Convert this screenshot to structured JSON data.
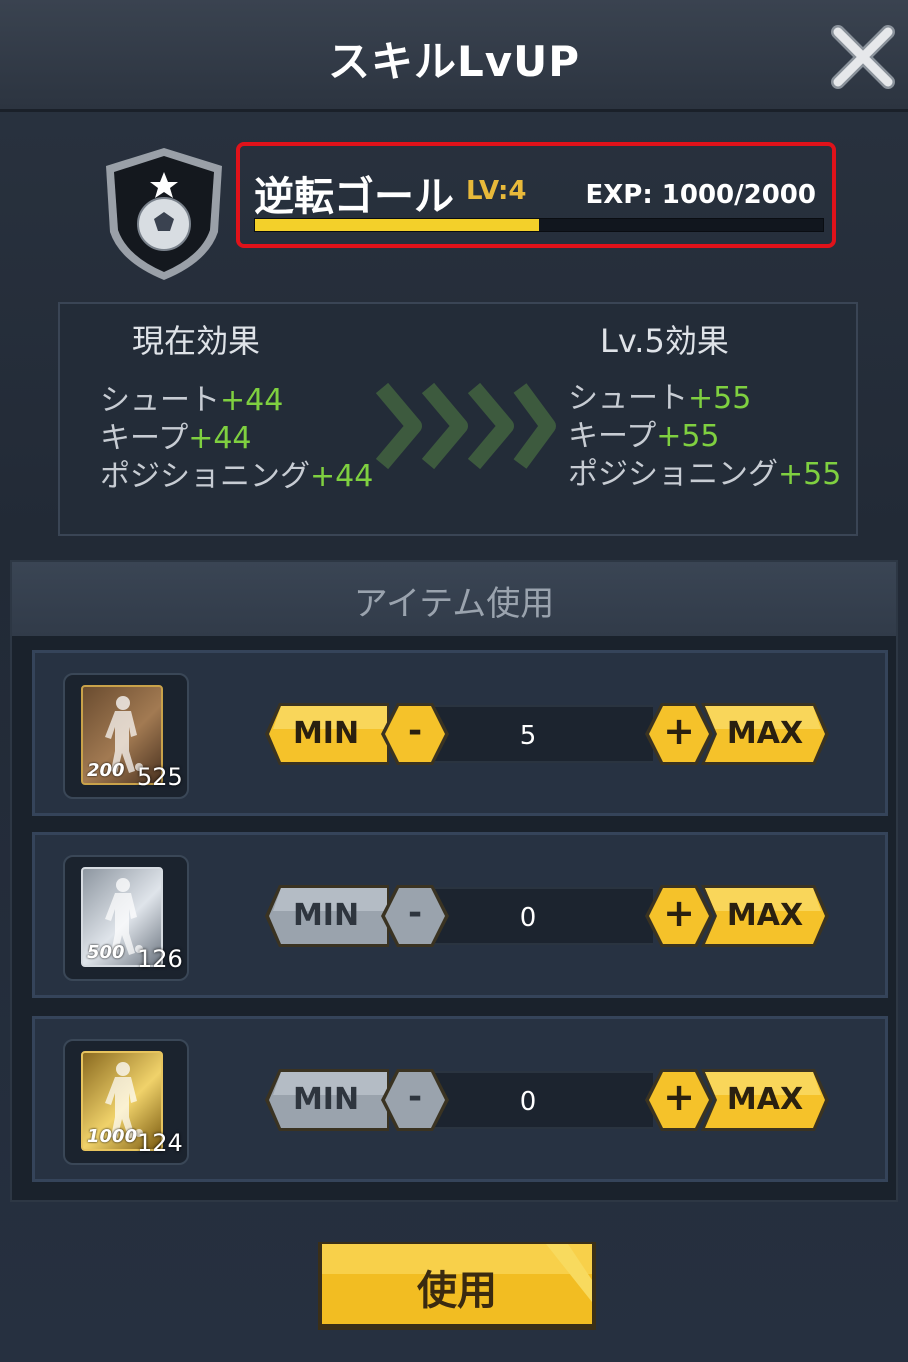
{
  "header": {
    "title": "スキルLvUP"
  },
  "skill": {
    "name": "逆転ゴール",
    "level_label": "LV:4",
    "exp_label": "EXP: 1000/2000",
    "exp_progress": 0.5
  },
  "effects": {
    "current_title": "現在効果",
    "next_title": "Lv.5効果",
    "current": [
      {
        "label": "シュート",
        "value": "+44"
      },
      {
        "label": "キープ",
        "value": "+44"
      },
      {
        "label": "ポジショニング",
        "value": "+44"
      }
    ],
    "next": [
      {
        "label": "シュート",
        "value": "+55"
      },
      {
        "label": "キープ",
        "value": "+55"
      },
      {
        "label": "ポジショニング",
        "value": "+55"
      }
    ]
  },
  "items": {
    "title": "アイテム使用",
    "rows": [
      {
        "card_value": "200",
        "count": "525",
        "quantity": "5",
        "min_label": "MIN",
        "max_label": "MAX",
        "minus_label": "-",
        "plus_label": "+",
        "tier": "bronze",
        "min_enabled": true
      },
      {
        "card_value": "500",
        "count": "126",
        "quantity": "0",
        "min_label": "MIN",
        "max_label": "MAX",
        "minus_label": "-",
        "plus_label": "+",
        "tier": "silver",
        "min_enabled": false
      },
      {
        "card_value": "1000",
        "count": "124",
        "quantity": "0",
        "min_label": "MIN",
        "max_label": "MAX",
        "minus_label": "-",
        "plus_label": "+",
        "tier": "gold",
        "min_enabled": false
      }
    ]
  },
  "use_button": {
    "label": "使用"
  },
  "colors": {
    "accent_yellow": "#f5c22a",
    "disabled_gray": "#9aa3ad",
    "highlight_red": "#e0121a",
    "effect_green": "#7fd040"
  }
}
